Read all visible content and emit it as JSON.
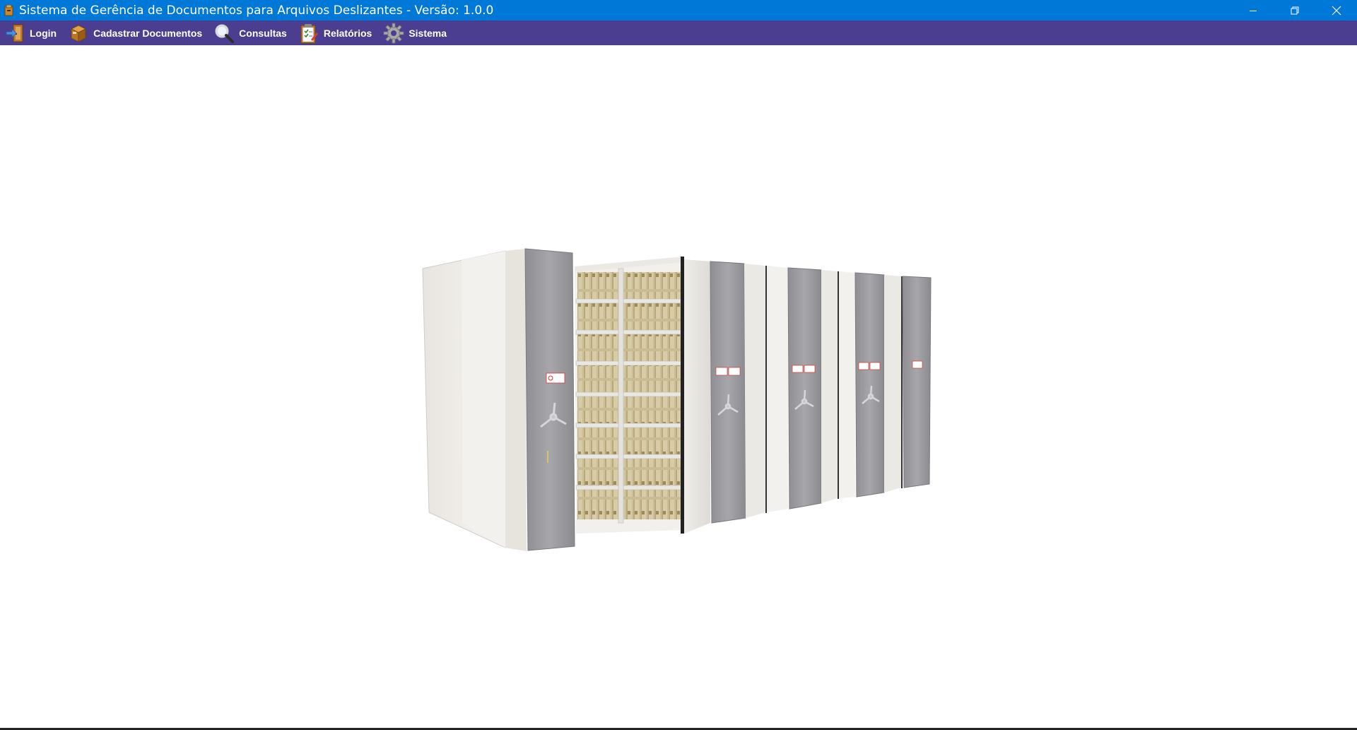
{
  "window": {
    "title": "Sistema de Gerência de Documentos para Arquivos Deslizantes - Versão: 1.0.0",
    "controls": [
      "minimize-icon",
      "restore-icon",
      "close-icon"
    ]
  },
  "menu": {
    "items": [
      {
        "label": "Login",
        "icon": "login-door-icon"
      },
      {
        "label": "Cadastrar Documentos",
        "icon": "box-icon"
      },
      {
        "label": "Consultas",
        "icon": "search-icon"
      },
      {
        "label": "Relatórios",
        "icon": "clipboard-icon"
      },
      {
        "label": "Sistema",
        "icon": "gear-icon"
      }
    ]
  },
  "main": {
    "image": "mobile-shelving-cabinet-illustration"
  },
  "colors": {
    "titlebar": "#0078d7",
    "menubar": "#4b3d8f",
    "background": "#ffffff"
  }
}
